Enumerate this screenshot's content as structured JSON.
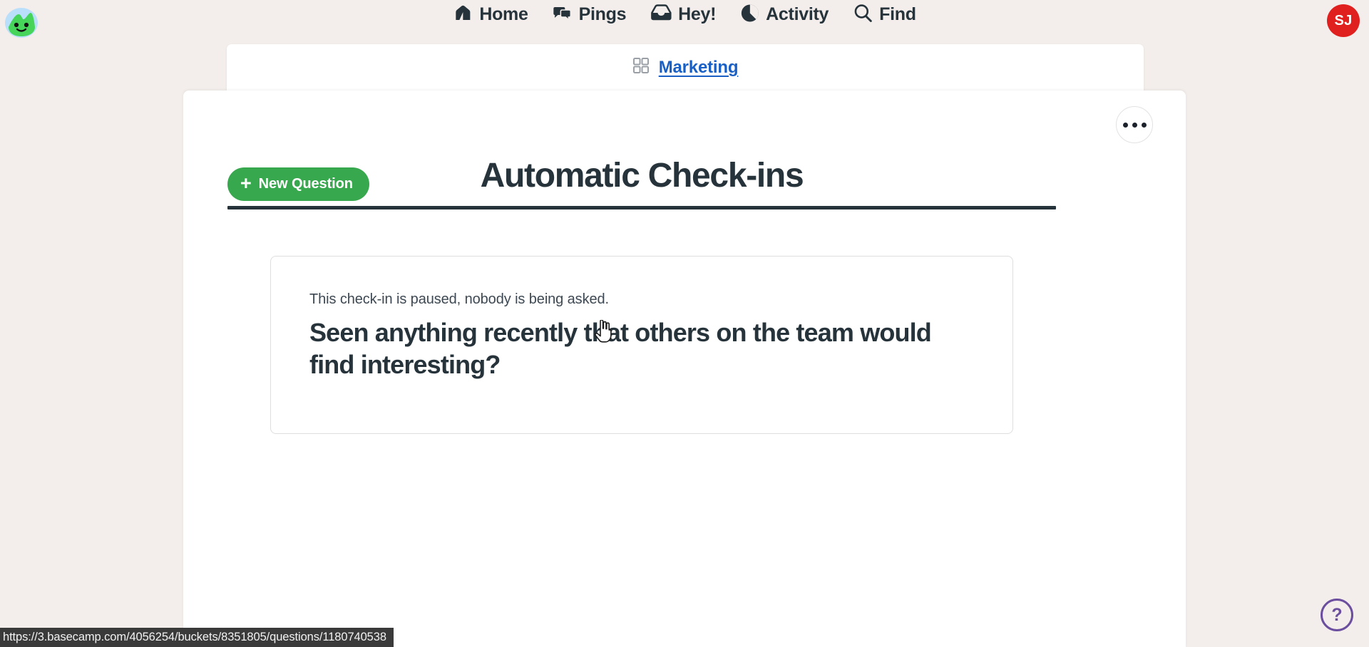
{
  "app": {
    "logo_icon": "basecamp-logo-icon",
    "accent_green": "#37a84e",
    "link_blue": "#1a60c4",
    "text_dark": "#26333b",
    "page_bg": "#f3eeeb",
    "avatar_color": "#e01f1f",
    "help_color": "#6b4f9e"
  },
  "topnav": {
    "items": [
      {
        "label": "Home",
        "icon": "home-icon"
      },
      {
        "label": "Pings",
        "icon": "pings-icon"
      },
      {
        "label": "Hey!",
        "icon": "hey-inbox-icon"
      },
      {
        "label": "Activity",
        "icon": "activity-pie-icon"
      },
      {
        "label": "Find",
        "icon": "search-icon"
      }
    ],
    "avatar_initials": "SJ"
  },
  "breadcrumb": {
    "icon": "grid-squares-icon",
    "label": "Marketing"
  },
  "toolbar": {
    "new_question_label": "New Question",
    "new_question_icon": "plus-icon",
    "more_menu_icon": "ellipsis-icon"
  },
  "page": {
    "title": "Automatic Check-ins"
  },
  "question_card": {
    "status": "This check-in is paused, nobody is being asked.",
    "question": "Seen anything recently that others on the team would find interesting?"
  },
  "help": {
    "label": "?"
  },
  "status_bar": {
    "url": "https://3.basecamp.com/4056254/buckets/8351805/questions/1180740538"
  }
}
